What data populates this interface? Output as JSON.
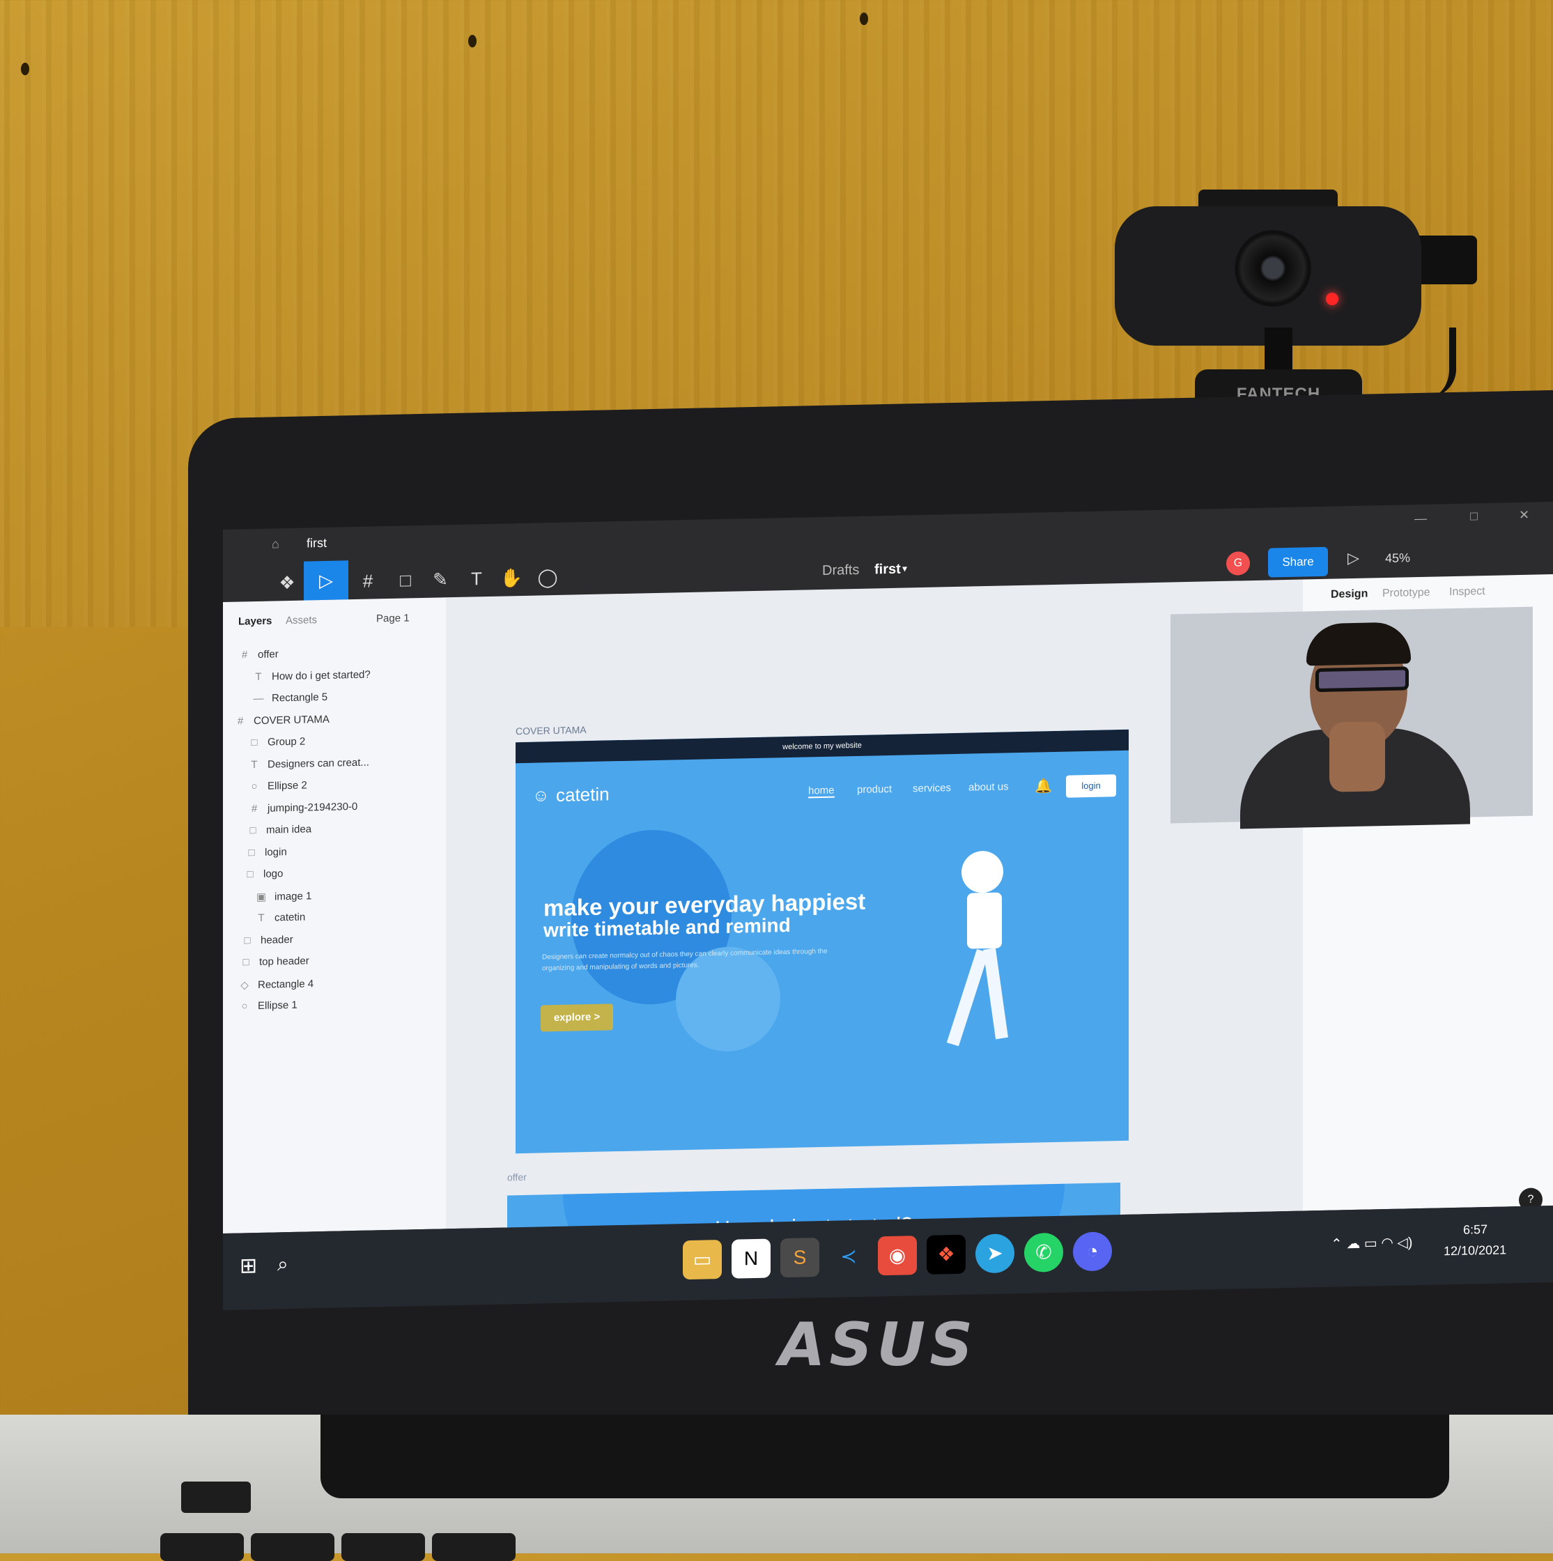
{
  "webcam_brand": "FANTECH",
  "laptop_brand": "ASUS",
  "window": {
    "tab_title": "first"
  },
  "toolbar": {
    "breadcrumb_drafts": "Drafts",
    "file_name": "first",
    "avatar_letter": "G",
    "share_label": "Share",
    "zoom": "45%"
  },
  "layers_panel": {
    "tab_layers": "Layers",
    "tab_assets": "Assets",
    "page": "Page 1",
    "items": [
      {
        "label": "offer",
        "icon": "#"
      },
      {
        "label": "How do i get started?",
        "icon": "T"
      },
      {
        "label": "Rectangle 5",
        "icon": "—"
      },
      {
        "label": "COVER UTAMA",
        "icon": "#"
      },
      {
        "label": "Group 2",
        "icon": "□"
      },
      {
        "label": "Designers can creat...",
        "icon": "T"
      },
      {
        "label": "Ellipse 2",
        "icon": "○"
      },
      {
        "label": "jumping-2194230-0",
        "icon": "#"
      },
      {
        "label": "main idea",
        "icon": "□"
      },
      {
        "label": "login",
        "icon": "□"
      },
      {
        "label": "logo",
        "icon": "□"
      },
      {
        "label": "image 1",
        "icon": "▣"
      },
      {
        "label": "catetin",
        "icon": "T"
      },
      {
        "label": "header",
        "icon": "□"
      },
      {
        "label": "top header",
        "icon": "□"
      },
      {
        "label": "Rectangle 4",
        "icon": "◇"
      },
      {
        "label": "Ellipse 1",
        "icon": "○"
      }
    ]
  },
  "right_panel": {
    "tabs": [
      "Design",
      "Prototype",
      "Inspect"
    ]
  },
  "canvas": {
    "frame_label": "COVER UTAMA",
    "offer_label": "offer",
    "site": {
      "top_banner": "welcome to my website",
      "logo": "catetin",
      "nav": [
        "home",
        "product",
        "services",
        "about us"
      ],
      "login": "login",
      "headline1": "make your everyday happiest",
      "headline2": "write timetable and remind",
      "description": "Designers can create normalcy out of chaos they can clearly communicate ideas through the organizing and manipulating of words and pictures.",
      "cta": "explore >",
      "offer_title": "How do i get started?"
    }
  },
  "taskbar": {
    "time": "6:57",
    "date": "12/10/2021"
  }
}
